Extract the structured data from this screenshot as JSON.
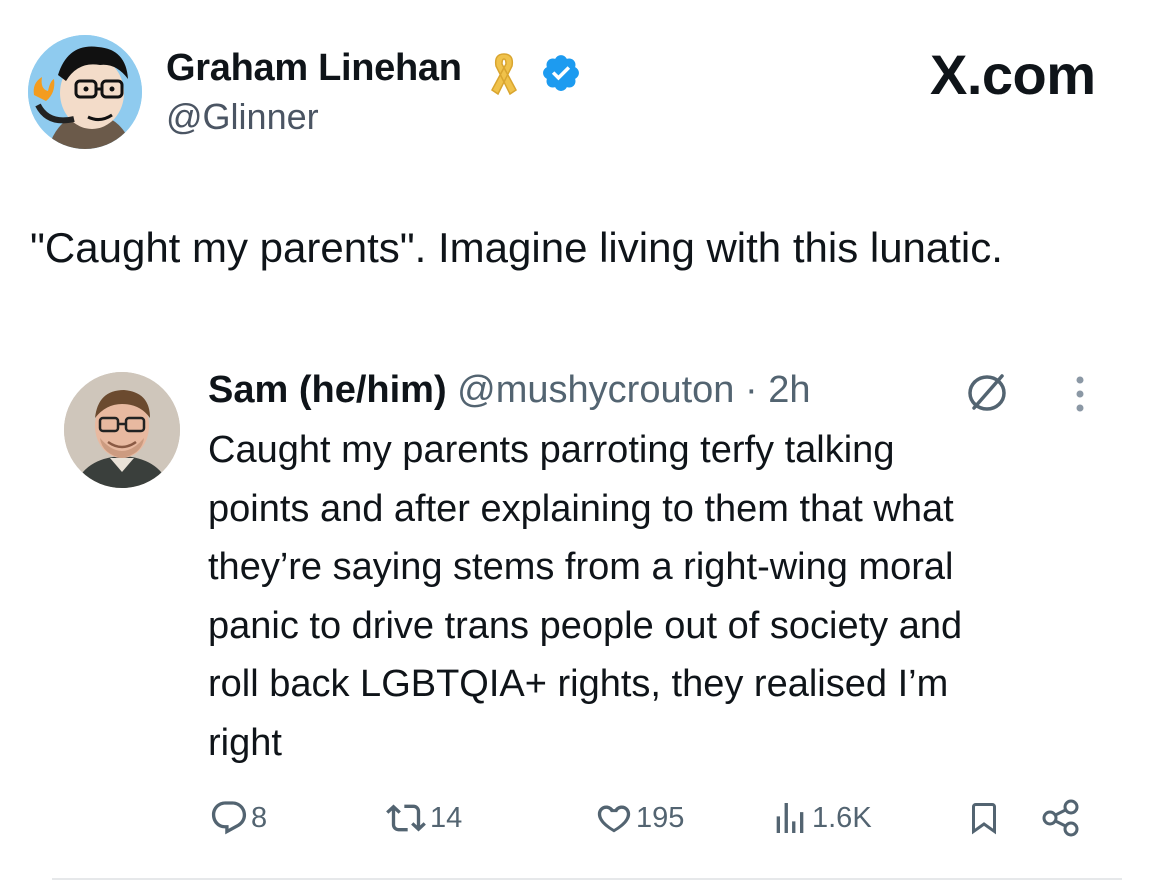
{
  "author": {
    "name": "Graham Linehan",
    "handle": "@Glinner"
  },
  "brand": {
    "logo_text": "X.com"
  },
  "tweet": {
    "text": "\"Caught my parents\". Imagine living with this lunatic."
  },
  "quoted_tweet": {
    "name": "Sam (he/him)",
    "handle": "@mushycrouton",
    "separator": "·",
    "time": "2h",
    "body_lines": [
      "Caught my parents parroting terfy talking",
      "points and after explaining to them that what",
      "they’re saying stems from a right-wing moral",
      "panic to drive trans people out of society and",
      "roll back LGBTQIA+ rights, they realised I’m",
      "right"
    ]
  },
  "actions": {
    "replies": "8",
    "retweets": "14",
    "likes": "195",
    "views": "1.6K"
  },
  "icons": {
    "ribbon": "gold-awareness-ribbon-icon",
    "verified": "verified-badge-icon",
    "no_reply": "replies-restricted-icon",
    "more": "more-options-icon",
    "reply": "reply-icon",
    "retweet": "retweet-icon",
    "like": "heart-icon",
    "views": "views-icon",
    "bookmark": "bookmark-icon",
    "share": "share-icon"
  },
  "colors": {
    "verified_blue": "#1d9bf0",
    "ribbon_gold": "#f0c24b",
    "secondary_text": "#536471",
    "primary_text": "#0f1419"
  }
}
